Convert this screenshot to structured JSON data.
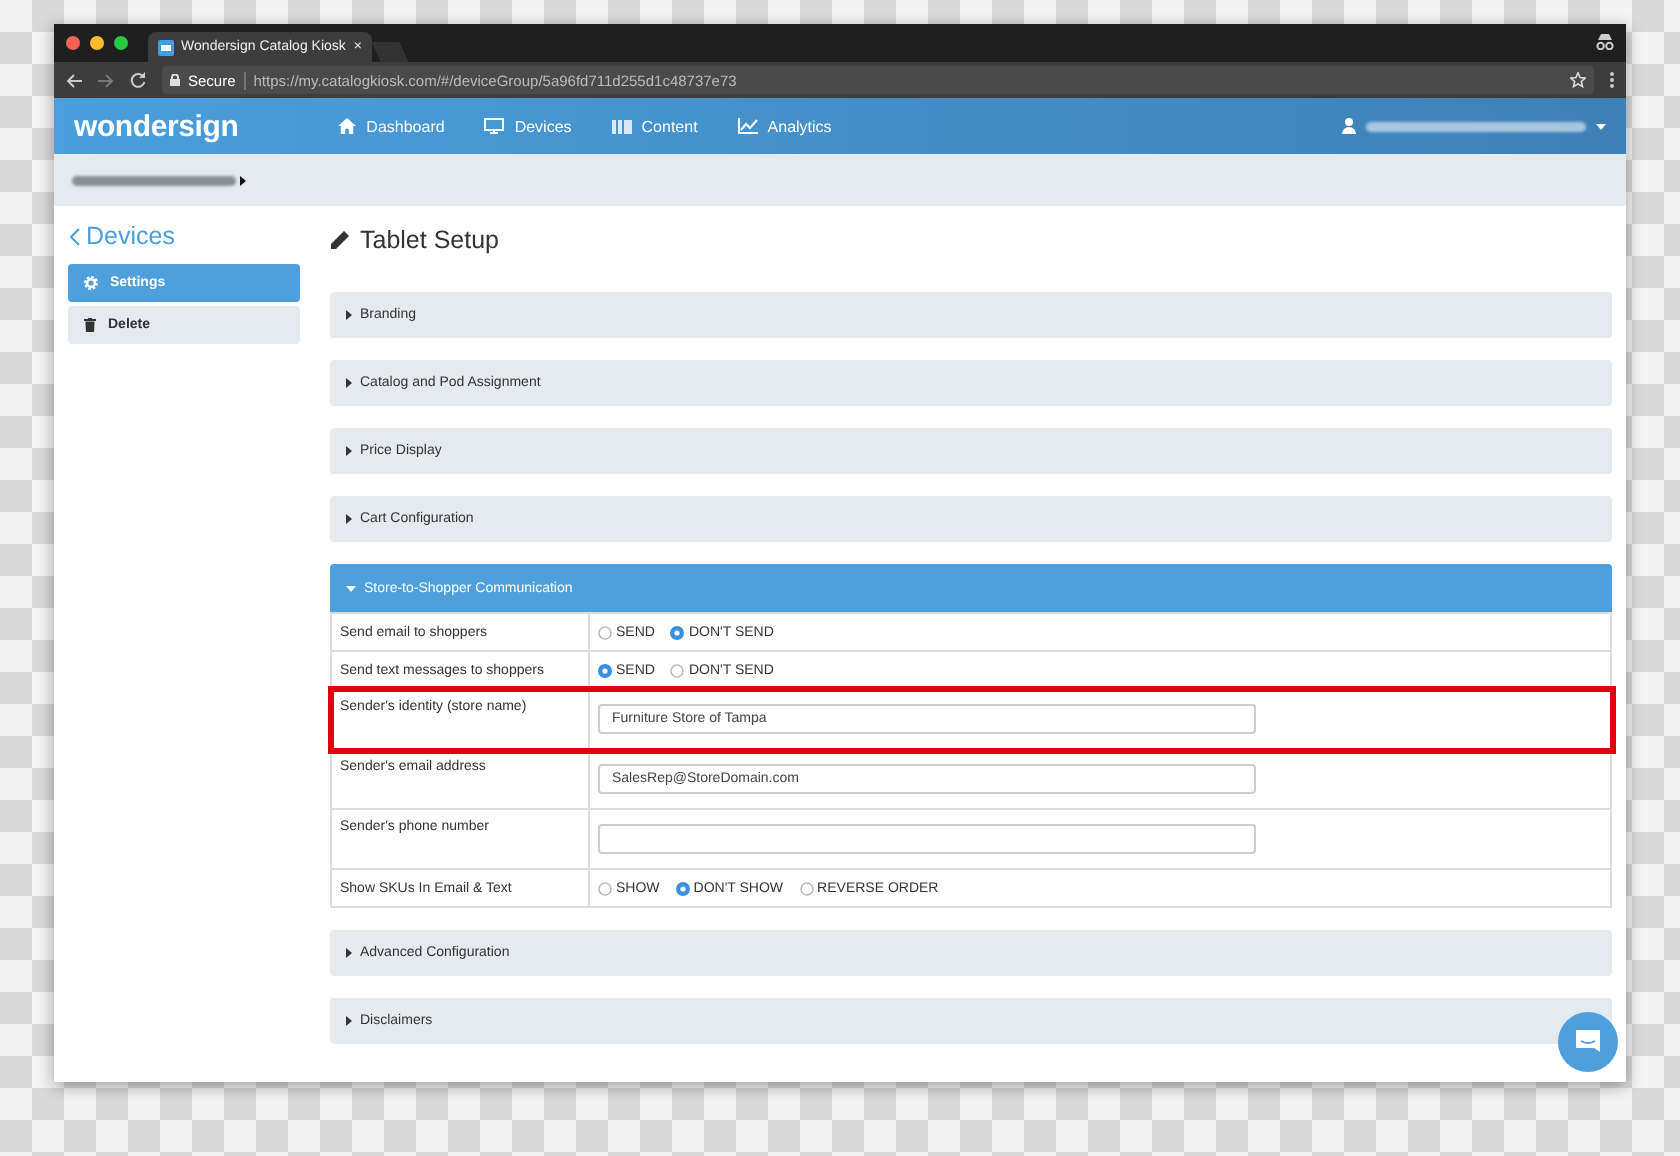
{
  "browser": {
    "tab_title": "Wondersign Catalog Kiosk",
    "tab_close": "×",
    "secure_label": "Secure",
    "url": "https://my.catalogkiosk.com/#/deviceGroup/5a96fd711d255d1c48737e73"
  },
  "nav": {
    "logo": "wondersign",
    "items": [
      {
        "label": "Dashboard"
      },
      {
        "label": "Devices"
      },
      {
        "label": "Content"
      },
      {
        "label": "Analytics"
      }
    ]
  },
  "sidebar": {
    "back_label": "Devices",
    "items": [
      {
        "label": "Settings",
        "selected": true
      },
      {
        "label": "Delete",
        "selected": false
      }
    ]
  },
  "page_title": "Tablet Setup",
  "sections": [
    {
      "title": "Branding",
      "expanded": false
    },
    {
      "title": "Catalog and Pod Assignment",
      "expanded": false
    },
    {
      "title": "Price Display",
      "expanded": false
    },
    {
      "title": "Cart Configuration",
      "expanded": false
    },
    {
      "title": "Store-to-Shopper Communication",
      "expanded": true,
      "rows": [
        {
          "label": "Send email to shoppers",
          "kind": "radio",
          "highlighted": false,
          "options": [
            {
              "label": "SEND",
              "selected": false
            },
            {
              "label": "DON'T SEND",
              "selected": true
            }
          ]
        },
        {
          "label": "Send text messages to shoppers",
          "kind": "radio",
          "highlighted": false,
          "options": [
            {
              "label": "SEND",
              "selected": true
            },
            {
              "label": "DON'T SEND",
              "selected": false
            }
          ]
        },
        {
          "label": "Sender's identity (store name)",
          "kind": "text",
          "highlighted": true,
          "value": "Furniture Store of Tampa"
        },
        {
          "label": "Sender's email address",
          "kind": "text",
          "highlighted": false,
          "value": "SalesRep@StoreDomain.com"
        },
        {
          "label": "Sender's phone number",
          "kind": "text",
          "highlighted": false
        },
        {
          "label": "Show SKUs In Email & Text",
          "kind": "radio",
          "highlighted": false,
          "options": [
            {
              "label": "SHOW",
              "selected": false
            },
            {
              "label": "DON'T SHOW",
              "selected": true
            },
            {
              "label": "REVERSE ORDER",
              "selected": false
            }
          ]
        }
      ]
    },
    {
      "title": "Advanced Configuration",
      "expanded": false
    },
    {
      "title": "Disclaimers",
      "expanded": false
    }
  ]
}
